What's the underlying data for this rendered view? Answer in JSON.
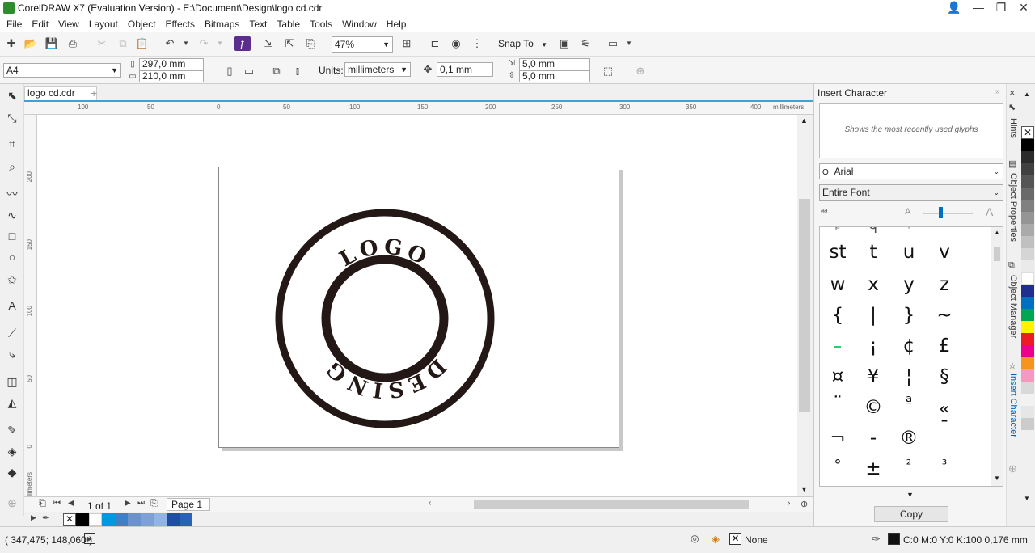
{
  "window": {
    "title": "CorelDRAW X7 (Evaluation Version) - E:\\Document\\Design\\logo cd.cdr"
  },
  "menu": [
    "File",
    "Edit",
    "View",
    "Layout",
    "Object",
    "Effects",
    "Bitmaps",
    "Text",
    "Table",
    "Tools",
    "Window",
    "Help"
  ],
  "standard_toolbar": {
    "zoom": "47%",
    "snap_to": "Snap To"
  },
  "property_bar": {
    "page_size": "A4",
    "width": "297,0 mm",
    "height": "210,0 mm",
    "units_label": "Units:",
    "units": "millimeters",
    "nudge": "0,1 mm",
    "dup_x": "5,0 mm",
    "dup_y": "5,0 mm"
  },
  "document": {
    "tab": "logo cd.cdr",
    "ruler_unit": "millimeters",
    "h_ruler_ticks": [
      "100",
      "50",
      "0",
      "50",
      "100",
      "150",
      "200",
      "250",
      "300",
      "350",
      "400"
    ],
    "v_ruler_ticks": [
      "200",
      "150",
      "100",
      "50",
      "0"
    ],
    "v_ruler_unit": "millimeters",
    "logo_top": "LOGO",
    "logo_bottom": "DESING"
  },
  "page_nav": {
    "counter": "1 of 1",
    "page_tab": "Page 1"
  },
  "docker": {
    "title": "Insert Character",
    "recent_hint": "Shows the most recently used glyphs",
    "font": "Arial",
    "subset": "Entire Font",
    "glyphs": [
      "st",
      "t",
      "u",
      "v",
      "w",
      "x",
      "y",
      "z",
      "{",
      "|",
      "}",
      "~",
      "",
      "¡",
      "¢",
      "£",
      "¤",
      "¥",
      "¦",
      "§",
      "¨",
      "©",
      "ª",
      "«",
      "¬",
      "-",
      "®",
      "¯",
      "°",
      "±",
      "²",
      "³"
    ],
    "copy_button": "Copy"
  },
  "docker_tabs": [
    "Hints",
    "Object Properties",
    "Object Manager",
    "Insert Character"
  ],
  "status": {
    "coords": "( 347,475; 148,060 )",
    "fill": "None",
    "outline": "C:0 M:0 Y:0 K:100  0,176 mm"
  },
  "colors": {
    "accent": "#3aa3d8",
    "logo_ink": "#231815",
    "bottom_palette": [
      "#000000",
      "#ffffff",
      "#0099dd",
      "#3f7fc6",
      "#6d92c9",
      "#7ea0d4",
      "#92b4e0",
      "#1e4fa0",
      "#2a62b5"
    ],
    "right_palette": [
      "#ffffff",
      "#000000",
      "#2b2b2b",
      "#404040",
      "#555555",
      "#6a6a6a",
      "#808080",
      "#959595",
      "#aaaaaa",
      "#c0c0c0",
      "#d5d5d5",
      "#eaeaea",
      "#ffffff",
      "#1f2f8f",
      "#0070c0",
      "#00a651",
      "#fff200",
      "#ed1c24",
      "#ec008c",
      "#f7941d",
      "#f49ac1",
      "#d9d9d9",
      "#f2f2f2",
      "#e6e6e6"
    ]
  }
}
